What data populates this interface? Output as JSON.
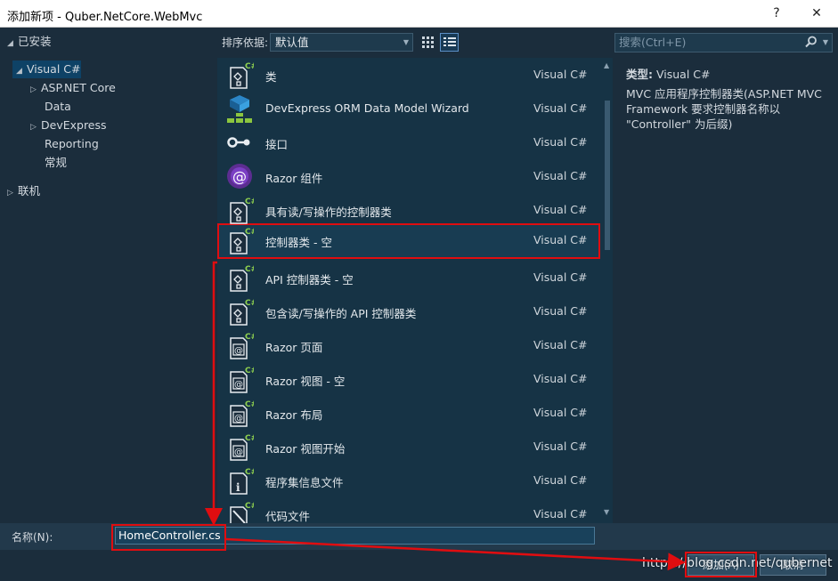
{
  "window": {
    "title": "添加新项 - Quber.NetCore.WebMvc",
    "help_label": "?",
    "close_label": "✕"
  },
  "tree": {
    "installed": "已安装",
    "visual_csharp": "Visual C#",
    "asp_net_core": "ASP.NET Core",
    "data": "Data",
    "devexpress": "DevExpress",
    "reporting": "Reporting",
    "general": "常规",
    "online": "联机"
  },
  "toolbar": {
    "sort_label": "排序依据:",
    "sort_value": "默认值"
  },
  "search": {
    "placeholder": "搜索(Ctrl+E)"
  },
  "templates": [
    {
      "name": "类",
      "lang": "Visual C#",
      "icon": "csharp-class-icon"
    },
    {
      "name": "DevExpress ORM Data Model Wizard",
      "lang": "Visual C#",
      "icon": "orm-wizard-icon"
    },
    {
      "name": "接口",
      "lang": "Visual C#",
      "icon": "interface-icon"
    },
    {
      "name": "Razor 组件",
      "lang": "Visual C#",
      "icon": "razor-component-icon"
    },
    {
      "name": "具有读/写操作的控制器类",
      "lang": "Visual C#",
      "icon": "controller-icon"
    },
    {
      "name": "控制器类 - 空",
      "lang": "Visual C#",
      "icon": "controller-icon"
    },
    {
      "name": "API 控制器类 - 空",
      "lang": "Visual C#",
      "icon": "controller-icon"
    },
    {
      "name": "包含读/写操作的 API 控制器类",
      "lang": "Visual C#",
      "icon": "controller-icon"
    },
    {
      "name": "Razor 页面",
      "lang": "Visual C#",
      "icon": "razor-page-icon"
    },
    {
      "name": "Razor 视图 - 空",
      "lang": "Visual C#",
      "icon": "razor-page-icon"
    },
    {
      "name": "Razor 布局",
      "lang": "Visual C#",
      "icon": "razor-page-icon"
    },
    {
      "name": "Razor 视图开始",
      "lang": "Visual C#",
      "icon": "razor-page-icon"
    },
    {
      "name": "程序集信息文件",
      "lang": "Visual C#",
      "icon": "assembly-info-icon"
    },
    {
      "name": "代码文件",
      "lang": "Visual C#",
      "icon": "code-file-icon"
    }
  ],
  "detail": {
    "type_label": "类型:",
    "type_value": "Visual C#",
    "description": "MVC 应用程序控制器类(ASP.NET MVC Framework 要求控制器名称以 \"Controller\" 为后缀)"
  },
  "name_field": {
    "label": "名称(N):",
    "value": "HomeController.cs"
  },
  "buttons": {
    "add": "添加(A)",
    "cancel": "取消"
  },
  "watermark": "https://blog.csdn.net/qubernet",
  "colors": {
    "background": "#1b2d3c",
    "list_background": "#163345",
    "selection": "#0e4266",
    "annotation_red": "#e00d10"
  }
}
